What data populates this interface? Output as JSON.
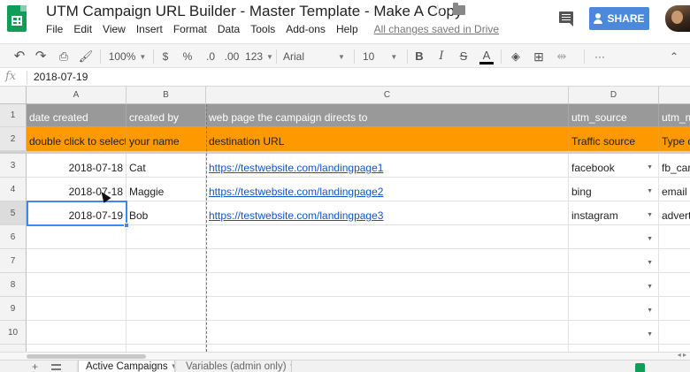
{
  "header": {
    "doc_title": "UTM Campaign URL Builder - Master Template - Make A Copy",
    "menu": [
      "File",
      "Edit",
      "View",
      "Insert",
      "Format",
      "Data",
      "Tools",
      "Add-ons",
      "Help"
    ],
    "save_status": "All changes saved in Drive",
    "share_label": "SHARE"
  },
  "toolbar": {
    "zoom": "100%",
    "currency": "$",
    "percent": "%",
    "dec_decrease": ".0",
    "dec_increase": ".00",
    "more_formats": "123",
    "font": "Arial",
    "font_size": "10",
    "bold": "B",
    "italic": "I",
    "strike": "S",
    "text_color": "A",
    "more": "···"
  },
  "formula_bar": {
    "fx_label": "fx",
    "value": "2018-07-19"
  },
  "grid": {
    "columns": [
      "A",
      "B",
      "C",
      "D"
    ],
    "row_numbers": [
      "1",
      "2",
      "3",
      "4",
      "5",
      "6",
      "7",
      "8",
      "9",
      "10"
    ],
    "header_row": [
      "date created",
      "created by",
      "web page the campaign directs to",
      "utm_source",
      "utm_m"
    ],
    "help_row": [
      "double click to select",
      "your name",
      "destination URL",
      "Traffic source",
      "Type o"
    ],
    "rows": [
      {
        "date": "2018-07-18",
        "by": "Cat",
        "url": "https://testwebsite.com/landingpage1",
        "source": "facebook",
        "medium": "fb_card"
      },
      {
        "date": "2018-07-18",
        "by": "Maggie",
        "url": "https://testwebsite.com/landingpage2",
        "source": "bing",
        "medium": "email"
      },
      {
        "date": "2018-07-19",
        "by": "Bob",
        "url": "https://testwebsite.com/landingpage3",
        "source": "instagram",
        "medium": "adverto"
      }
    ]
  },
  "sheets": {
    "active": "Active Campaigns",
    "other": "Variables (admin only)"
  },
  "colors": {
    "header_row_bg": "#999999",
    "help_row_bg": "#ff9900",
    "selection": "#4285f4",
    "share_button": "#4a89dc",
    "app_green": "#0f9d58"
  }
}
